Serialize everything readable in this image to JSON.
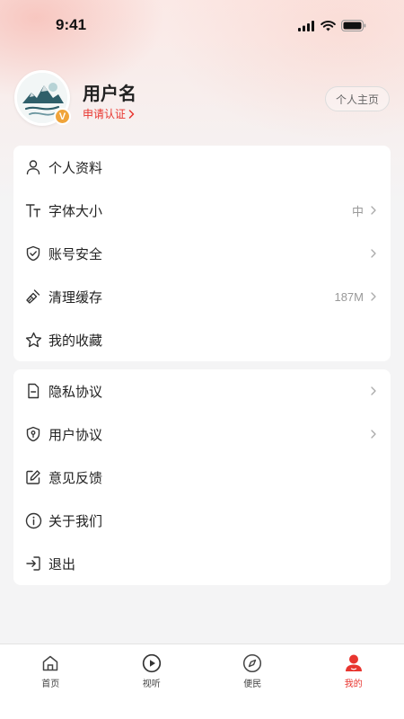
{
  "status": {
    "time": "9:41"
  },
  "profile": {
    "username": "用户名",
    "verify_label": "申请认证",
    "badge": "V",
    "homepage_button": "个人主页"
  },
  "menu_group1": [
    {
      "label": "个人资料",
      "icon": "person-icon",
      "value": "",
      "has_chevron": false
    },
    {
      "label": "字体大小",
      "icon": "font-size-icon",
      "value": "中",
      "has_chevron": true
    },
    {
      "label": "账号安全",
      "icon": "shield-check-icon",
      "value": "",
      "has_chevron": true
    },
    {
      "label": "清理缓存",
      "icon": "broom-icon",
      "value": "187M",
      "has_chevron": true
    },
    {
      "label": "我的收藏",
      "icon": "star-icon",
      "value": "",
      "has_chevron": false
    }
  ],
  "menu_group2": [
    {
      "label": "隐私协议",
      "icon": "document-icon",
      "value": "",
      "has_chevron": true
    },
    {
      "label": "用户协议",
      "icon": "shield-user-icon",
      "value": "",
      "has_chevron": true
    },
    {
      "label": "意见反馈",
      "icon": "edit-icon",
      "value": "",
      "has_chevron": false
    },
    {
      "label": "关于我们",
      "icon": "info-icon",
      "value": "",
      "has_chevron": false
    },
    {
      "label": "退出",
      "icon": "logout-icon",
      "value": "",
      "has_chevron": false
    }
  ],
  "tabbar": [
    {
      "label": "首页",
      "icon": "home-icon",
      "active": false
    },
    {
      "label": "视听",
      "icon": "play-icon",
      "active": false
    },
    {
      "label": "便民",
      "icon": "compass-icon",
      "active": false
    },
    {
      "label": "我的",
      "icon": "user-icon",
      "active": true
    }
  ],
  "colors": {
    "accent": "#e8352f",
    "badge": "#f0a43a",
    "background": "#f4f4f5"
  }
}
